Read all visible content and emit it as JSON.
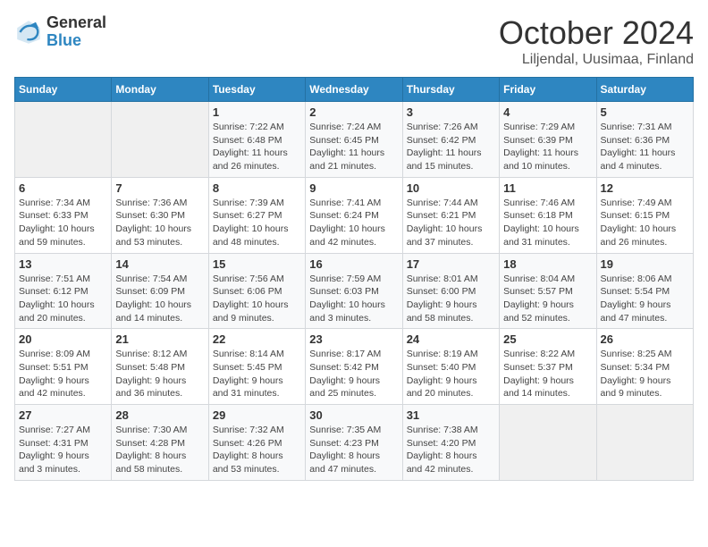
{
  "header": {
    "logo": {
      "line1": "General",
      "line2": "Blue"
    },
    "title": "October 2024",
    "subtitle": "Liljendal, Uusimaa, Finland"
  },
  "weekdays": [
    "Sunday",
    "Monday",
    "Tuesday",
    "Wednesday",
    "Thursday",
    "Friday",
    "Saturday"
  ],
  "weeks": [
    [
      {
        "day": "",
        "info": ""
      },
      {
        "day": "",
        "info": ""
      },
      {
        "day": "1",
        "info": "Sunrise: 7:22 AM\nSunset: 6:48 PM\nDaylight: 11 hours\nand 26 minutes."
      },
      {
        "day": "2",
        "info": "Sunrise: 7:24 AM\nSunset: 6:45 PM\nDaylight: 11 hours\nand 21 minutes."
      },
      {
        "day": "3",
        "info": "Sunrise: 7:26 AM\nSunset: 6:42 PM\nDaylight: 11 hours\nand 15 minutes."
      },
      {
        "day": "4",
        "info": "Sunrise: 7:29 AM\nSunset: 6:39 PM\nDaylight: 11 hours\nand 10 minutes."
      },
      {
        "day": "5",
        "info": "Sunrise: 7:31 AM\nSunset: 6:36 PM\nDaylight: 11 hours\nand 4 minutes."
      }
    ],
    [
      {
        "day": "6",
        "info": "Sunrise: 7:34 AM\nSunset: 6:33 PM\nDaylight: 10 hours\nand 59 minutes."
      },
      {
        "day": "7",
        "info": "Sunrise: 7:36 AM\nSunset: 6:30 PM\nDaylight: 10 hours\nand 53 minutes."
      },
      {
        "day": "8",
        "info": "Sunrise: 7:39 AM\nSunset: 6:27 PM\nDaylight: 10 hours\nand 48 minutes."
      },
      {
        "day": "9",
        "info": "Sunrise: 7:41 AM\nSunset: 6:24 PM\nDaylight: 10 hours\nand 42 minutes."
      },
      {
        "day": "10",
        "info": "Sunrise: 7:44 AM\nSunset: 6:21 PM\nDaylight: 10 hours\nand 37 minutes."
      },
      {
        "day": "11",
        "info": "Sunrise: 7:46 AM\nSunset: 6:18 PM\nDaylight: 10 hours\nand 31 minutes."
      },
      {
        "day": "12",
        "info": "Sunrise: 7:49 AM\nSunset: 6:15 PM\nDaylight: 10 hours\nand 26 minutes."
      }
    ],
    [
      {
        "day": "13",
        "info": "Sunrise: 7:51 AM\nSunset: 6:12 PM\nDaylight: 10 hours\nand 20 minutes."
      },
      {
        "day": "14",
        "info": "Sunrise: 7:54 AM\nSunset: 6:09 PM\nDaylight: 10 hours\nand 14 minutes."
      },
      {
        "day": "15",
        "info": "Sunrise: 7:56 AM\nSunset: 6:06 PM\nDaylight: 10 hours\nand 9 minutes."
      },
      {
        "day": "16",
        "info": "Sunrise: 7:59 AM\nSunset: 6:03 PM\nDaylight: 10 hours\nand 3 minutes."
      },
      {
        "day": "17",
        "info": "Sunrise: 8:01 AM\nSunset: 6:00 PM\nDaylight: 9 hours\nand 58 minutes."
      },
      {
        "day": "18",
        "info": "Sunrise: 8:04 AM\nSunset: 5:57 PM\nDaylight: 9 hours\nand 52 minutes."
      },
      {
        "day": "19",
        "info": "Sunrise: 8:06 AM\nSunset: 5:54 PM\nDaylight: 9 hours\nand 47 minutes."
      }
    ],
    [
      {
        "day": "20",
        "info": "Sunrise: 8:09 AM\nSunset: 5:51 PM\nDaylight: 9 hours\nand 42 minutes."
      },
      {
        "day": "21",
        "info": "Sunrise: 8:12 AM\nSunset: 5:48 PM\nDaylight: 9 hours\nand 36 minutes."
      },
      {
        "day": "22",
        "info": "Sunrise: 8:14 AM\nSunset: 5:45 PM\nDaylight: 9 hours\nand 31 minutes."
      },
      {
        "day": "23",
        "info": "Sunrise: 8:17 AM\nSunset: 5:42 PM\nDaylight: 9 hours\nand 25 minutes."
      },
      {
        "day": "24",
        "info": "Sunrise: 8:19 AM\nSunset: 5:40 PM\nDaylight: 9 hours\nand 20 minutes."
      },
      {
        "day": "25",
        "info": "Sunrise: 8:22 AM\nSunset: 5:37 PM\nDaylight: 9 hours\nand 14 minutes."
      },
      {
        "day": "26",
        "info": "Sunrise: 8:25 AM\nSunset: 5:34 PM\nDaylight: 9 hours\nand 9 minutes."
      }
    ],
    [
      {
        "day": "27",
        "info": "Sunrise: 7:27 AM\nSunset: 4:31 PM\nDaylight: 9 hours\nand 3 minutes."
      },
      {
        "day": "28",
        "info": "Sunrise: 7:30 AM\nSunset: 4:28 PM\nDaylight: 8 hours\nand 58 minutes."
      },
      {
        "day": "29",
        "info": "Sunrise: 7:32 AM\nSunset: 4:26 PM\nDaylight: 8 hours\nand 53 minutes."
      },
      {
        "day": "30",
        "info": "Sunrise: 7:35 AM\nSunset: 4:23 PM\nDaylight: 8 hours\nand 47 minutes."
      },
      {
        "day": "31",
        "info": "Sunrise: 7:38 AM\nSunset: 4:20 PM\nDaylight: 8 hours\nand 42 minutes."
      },
      {
        "day": "",
        "info": ""
      },
      {
        "day": "",
        "info": ""
      }
    ]
  ]
}
